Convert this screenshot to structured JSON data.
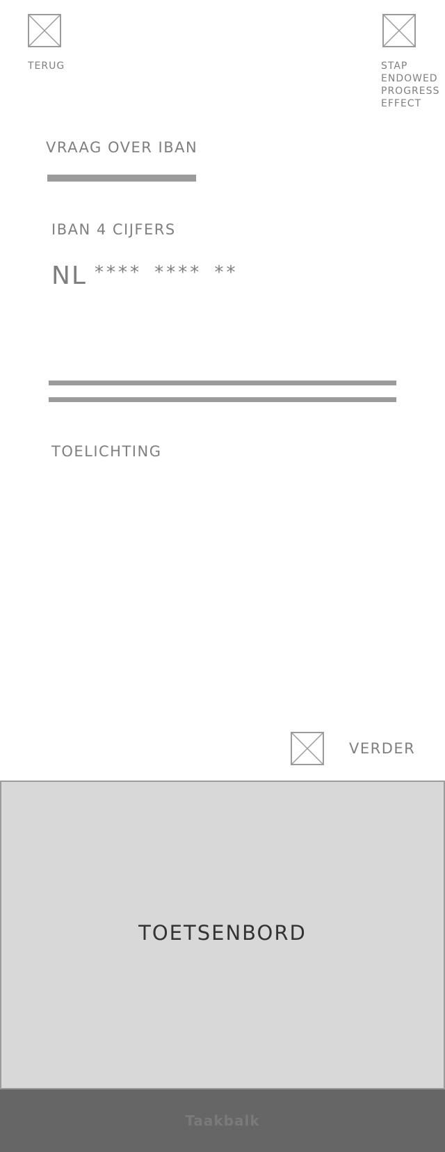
{
  "header": {
    "back_label": "TERUG",
    "step_label": "STAP\nENDOWED\nPROGRESS\nEFFECT",
    "back_icon": "image-placeholder-icon",
    "step_icon": "image-placeholder-icon"
  },
  "question": {
    "title": "VRAAG OVER IBAN",
    "progress_fraction": 0.61
  },
  "iban": {
    "label": "IBAN 4 CIJFERS",
    "prefix": "NL",
    "mask": "**** **** **"
  },
  "explanation": {
    "label": "TOELICHTING"
  },
  "footer": {
    "next_label": "VERDER",
    "next_icon": "image-placeholder-icon"
  },
  "keyboard": {
    "label": "TOETSENBORD"
  },
  "taskbar": {
    "label": "Taakbalk"
  },
  "colors": {
    "placeholder_stroke": "#9b9b9b",
    "text": "#7f7f7f",
    "keyboard_bg": "#d8d8d8",
    "taskbar_bg": "#666666"
  }
}
